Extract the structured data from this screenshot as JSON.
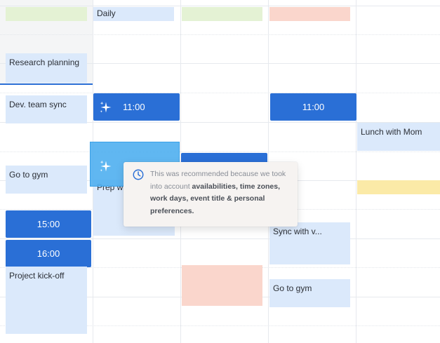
{
  "events": {
    "daily": "Daily",
    "research_planning": "Research planning",
    "dev_team_sync": "Dev. team sync",
    "go_to_gym_1": "Go to gym",
    "project_kickoff": "Project kick-off",
    "prep": "Prep wi",
    "lunch_with_mom": "Lunch with Mom",
    "sync_with": "Sync with v...",
    "go_to_gym_2": "Go to gym"
  },
  "slots": {
    "suggest_1100_a": "11:00",
    "suggest_1100_b": "11:00",
    "slot_1500": "15:00",
    "slot_1600": "16:00"
  },
  "tooltip": {
    "text_prefix": "This was recommended because we took into account ",
    "reasons": "availabilities, time zones, work days, event title & personal preferences."
  },
  "colors": {
    "primary": "#2a6fd6",
    "light_blue": "#dbe9fb",
    "green": "#e4f2d4",
    "peach": "#fad6cc",
    "yellow": "#fbeaa7",
    "highlight": "#4fafe0"
  },
  "icons": {
    "sparkle": "sparkle-icon",
    "clock": "clock-icon"
  }
}
